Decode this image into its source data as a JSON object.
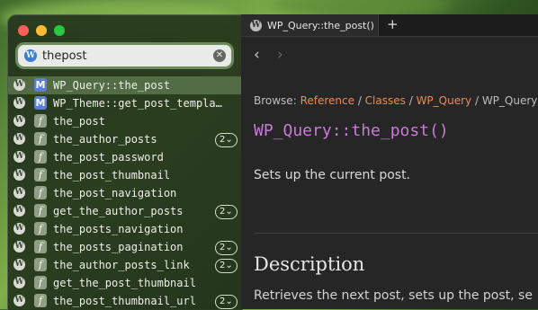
{
  "colors": {
    "link": "#e98b5a",
    "function_title": "#c97ad8",
    "method_icon": "#5c7fd6",
    "function_icon": "#8e9f83",
    "selection": "#6e8c5f"
  },
  "search": {
    "icon": "wordpress-icon",
    "value": "thepost",
    "clear_icon": "clear-icon"
  },
  "results": [
    {
      "type": "M",
      "name": "WP_Query::the_post",
      "badge": ""
    },
    {
      "type": "M",
      "name": "WP_Theme::get_post_templa…",
      "badge": ""
    },
    {
      "type": "f",
      "name": "the_post",
      "badge": ""
    },
    {
      "type": "f",
      "name": "the_author_posts",
      "badge": "2⌄"
    },
    {
      "type": "f",
      "name": "the_post_password",
      "badge": ""
    },
    {
      "type": "f",
      "name": "the_post_thumbnail",
      "badge": ""
    },
    {
      "type": "f",
      "name": "the_post_navigation",
      "badge": ""
    },
    {
      "type": "f",
      "name": "get_the_author_posts",
      "badge": "2⌄"
    },
    {
      "type": "f",
      "name": "the_posts_navigation",
      "badge": ""
    },
    {
      "type": "f",
      "name": "the_posts_pagination",
      "badge": "2⌄"
    },
    {
      "type": "f",
      "name": "the_author_posts_link",
      "badge": "2⌄"
    },
    {
      "type": "f",
      "name": "get_the_post_thumbnail",
      "badge": ""
    },
    {
      "type": "f",
      "name": "the_post_thumbnail_url",
      "badge": "2⌄"
    }
  ],
  "tab": {
    "title": "WP_Query::the_post()",
    "new_tab": "+"
  },
  "nav": {
    "back": "‹",
    "forward": "›"
  },
  "breadcrumb": {
    "prefix": "Browse: ",
    "items": [
      "Reference",
      "Classes",
      "WP_Query"
    ],
    "separator": " / ",
    "current": "WP_Query"
  },
  "doc": {
    "title": "WP_Query::the_post()",
    "summary": "Sets up the current post.",
    "section_heading": "Description",
    "section_body": "Retrieves the next post, sets up the post, se"
  }
}
